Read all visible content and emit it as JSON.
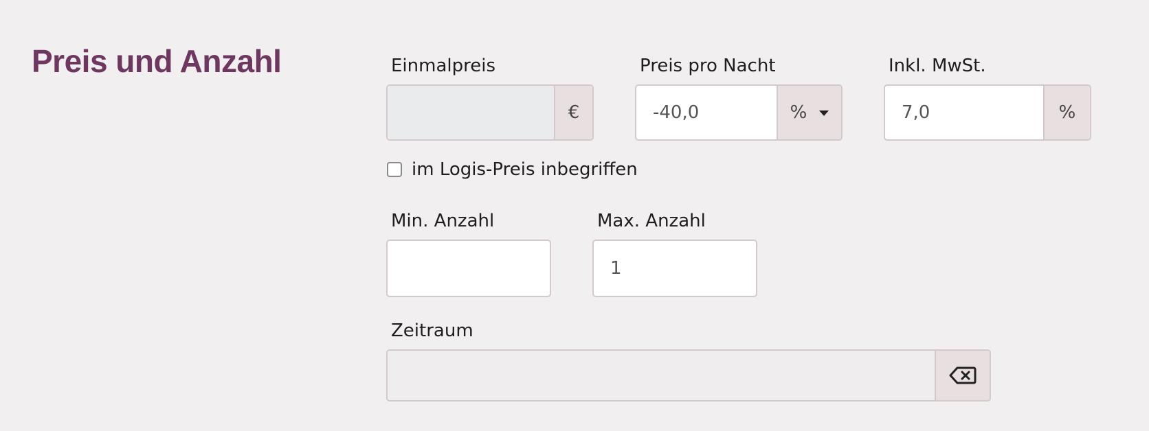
{
  "section": {
    "title": "Preis und Anzahl"
  },
  "einmalpreis": {
    "label": "Einmalpreis",
    "value": "",
    "unit": "€",
    "disabled": true
  },
  "preis_pro_nacht": {
    "label": "Preis pro Nacht",
    "value": "-40,0",
    "unit": "%"
  },
  "inkl_mwst": {
    "label": "Inkl. MwSt.",
    "value": "7,0",
    "unit": "%"
  },
  "logis_checkbox": {
    "label": "im Logis-Preis inbegriffen",
    "checked": false
  },
  "min_anzahl": {
    "label": "Min. Anzahl",
    "value": ""
  },
  "max_anzahl": {
    "label": "Max. Anzahl",
    "value": "1"
  },
  "zeitraum": {
    "label": "Zeitraum",
    "value": ""
  },
  "icons": {
    "clear": "backspace-icon",
    "dropdown": "caret-down-icon"
  },
  "colors": {
    "title": "#6d3760",
    "background": "#f2eff0",
    "addon": "#e8dfe0",
    "border": "#d3c9ca",
    "disabled_input": "#e9ebed"
  }
}
